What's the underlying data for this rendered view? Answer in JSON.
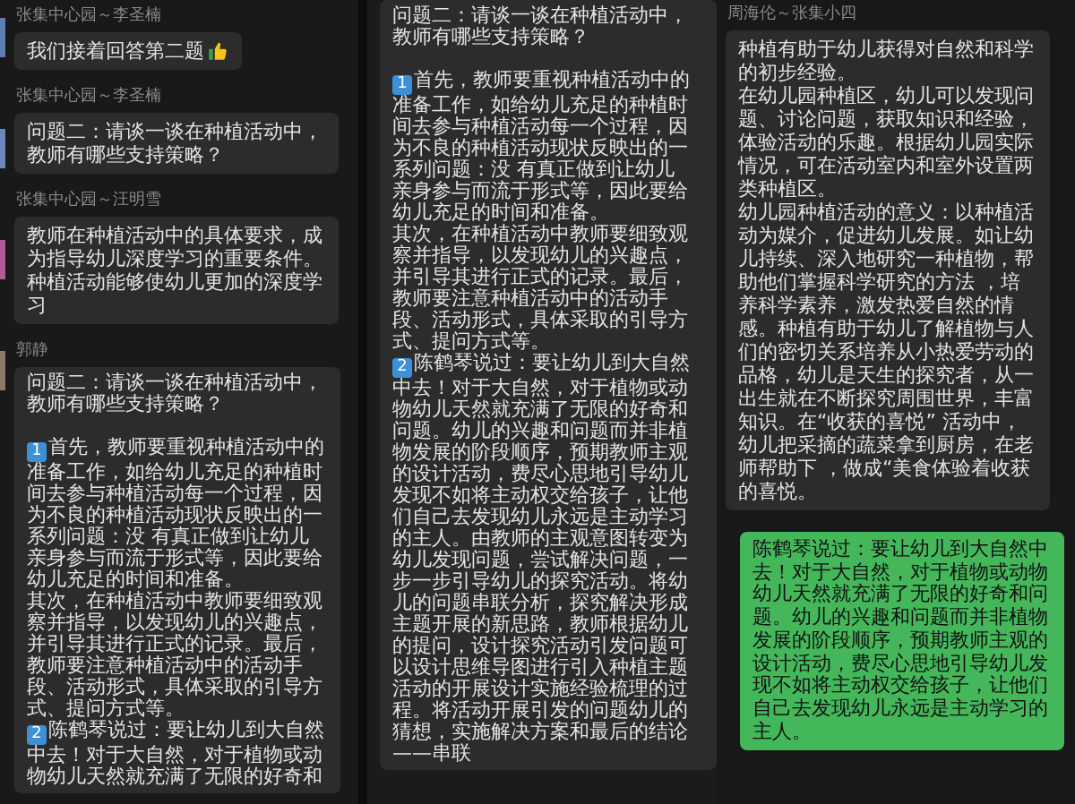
{
  "panels": [
    {
      "messages": [
        {
          "kind": "text",
          "sender": "张集中心园～李圣楠",
          "outgoing": false,
          "paragraphs": [
            "我们接着回答第二题"
          ],
          "thumbs_up": true
        },
        {
          "kind": "text",
          "sender": "张集中心园～李圣楠",
          "outgoing": false,
          "paragraphs": [
            "问题二：请谈一谈在种植活动中，教师有哪些支持策略？"
          ],
          "thumbs_up": false
        },
        {
          "kind": "text",
          "sender": "张集中心园～汪明雪",
          "outgoing": false,
          "paragraphs": [
            "教师在种植活动中的具体要求，成为指导幼儿深度学习的重要条件。种植活动能够使幼儿更加的深度学习"
          ],
          "thumbs_up": false
        },
        {
          "kind": "answer",
          "sender": "郭静",
          "outgoing": false,
          "question": "问题二：请谈一谈在种植活动中，教师有哪些支持策略？",
          "points": [
            {
              "marker": "1",
              "paragraphs": [
                "首先，教师要重视种植活动中的准备工作，如给幼儿充足的种植时间去参与种植活动每一个过程，因为不良的种植活动现状反映出的一系列问题：没 有真正做到让幼儿亲身参与而流于形式等，因此要给幼儿充足的时间和准备。",
                "其次，在种植活动中教师要细致观察并指导，以发现幼儿的兴趣点，并引导其进行正式的记录。最后，教师要注意种植活动中的活动手段、活动形式，具体采取的引导方式、提问方式等。"
              ]
            },
            {
              "marker": "2",
              "paragraphs": [
                "陈鹤琴说过：要让幼儿到大自然中去！对于大自然，对于植物或动物幼儿天然就充满了无限的好奇和"
              ]
            }
          ]
        }
      ]
    },
    {
      "messages": [
        {
          "kind": "answer",
          "outgoing": false,
          "question": "问题二：请谈一谈在种植活动中，教师有哪些支持策略？",
          "points": [
            {
              "marker": "1",
              "paragraphs": [
                "首先，教师要重视种植活动中的准备工作，如给幼儿充足的种植时间去参与种植活动每一个过程，因为不良的种植活动现状反映出的一系列问题：没 有真正做到让幼儿亲身参与而流于形式等，因此要给幼儿充足的时间和准备。",
                "其次，在种植活动中教师要细致观察并指导，以发现幼儿的兴趣点，并引导其进行正式的记录。最后，教师要注意种植活动中的活动手段、活动形式，具体采取的引导方式、提问方式等。"
              ]
            },
            {
              "marker": "2",
              "paragraphs": [
                "陈鹤琴说过：要让幼儿到大自然中去！对于大自然，对于植物或动物幼儿天然就充满了无限的好奇和问题。幼儿的兴趣和问题而并非植物发展的阶段顺序，预期教师主观的设计活动，费尽心思地引导幼儿发现不如将主动权交给孩子，让他们自己去发现幼儿永远是主动学习的主人。由教师的主观意图转变为幼儿发现问题，尝试解决问题，一步一步引导幼儿的探究活动。将幼儿的问题串联分析，探究解决形成主题开展的新思路，教师根据幼儿的提问，设计探究活动引发问题可以设计思维导图进行引入种植主题活动的开展设计实施经验梳理的过程。将活动开展引发的问题幼儿的猜想，实施解决方案和最后的结论——串联"
              ]
            }
          ]
        }
      ]
    },
    {
      "messages": [
        {
          "kind": "text",
          "sender": "周海伦～张集小四",
          "outgoing": false,
          "paragraphs": [
            "种植有助于幼儿获得对自然和科学的初步经验。",
            "在幼儿园种植区，幼儿可以发现问题、讨论问题，获取知识和经验，体验活动的乐趣。根据幼儿园实际情况，可在活动室内和室外设置两类种植区。",
            "幼儿园种植活动的意义：以种植活动为媒介，促进幼儿发展。如让幼儿持续、深入地研究一种植物，帮助他们掌握科学研究的方法 ，培养科学素养，激发热爱自然的情感。种植有助于幼儿了解植物与人们的密切关系培养从小热爱劳动的品格，幼儿是天生的探究者，从一出生就在不断探究周围世界，丰富知识。在“收获的喜悦” 活动中，幼儿把采摘的蔬菜拿到厨房，在老师帮助下 ，做成“美食体验着收获的喜悦。"
          ],
          "thumbs_up": false
        },
        {
          "kind": "text",
          "outgoing": true,
          "paragraphs": [
            "陈鹤琴说过：要让幼儿到大自然中去！对于大自然，对于植物或动物幼儿天然就充满了无限的好奇和问题。幼儿的兴趣和问题而并非植物发展的阶段顺序，预期教师主观的设计活动，费尽心思地引导幼儿发现不如将主动权交给孩子，让他们自己去发现幼儿永远是主动学习的主人。"
          ],
          "thumbs_up": false
        }
      ]
    }
  ]
}
